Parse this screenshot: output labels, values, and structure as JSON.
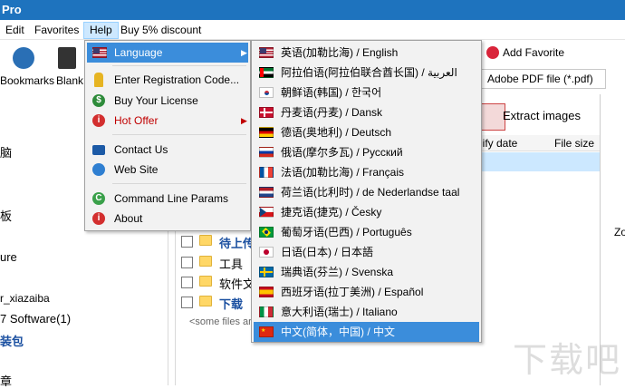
{
  "titlebar": {
    "title": "Pro"
  },
  "menubar": {
    "items": [
      "Edit",
      "Favorites",
      "Help",
      "Buy 5% discount"
    ]
  },
  "toolbar": {
    "bookmarks_label": "Bookmarks",
    "blank_label": "Blank p",
    "add_favorite_label": "Add Favorite",
    "file_type_value": "Adobe PDF file (*.pdf)",
    "extract_label": "Extract images",
    "zoom_partial": "Zo"
  },
  "left_panel": {
    "items": [
      "脑",
      "板",
      "ure",
      "r_xiazaiba",
      "7 Software(1)",
      "装包",
      "章"
    ]
  },
  "file_list": {
    "columns": {
      "modified": "lify date",
      "size": "File size"
    },
    "rows": [
      {
        "name": "待上传"
      },
      {
        "name": "工具"
      },
      {
        "name": "软件文"
      },
      {
        "name": "下载"
      }
    ],
    "hidden_note": "<some files are"
  },
  "help_menu": {
    "items": [
      {
        "label": "Language",
        "icon": "us-flag-icon",
        "submenu": true
      },
      {
        "label": "Enter Registration Code...",
        "icon": "key-icon"
      },
      {
        "label": "Buy Your License",
        "icon": "dollar-icon"
      },
      {
        "label": "Hot Offer",
        "icon": "info-icon",
        "submenu": true
      },
      {
        "label": "Contact Us",
        "icon": "mail-icon"
      },
      {
        "label": "Web Site",
        "icon": "globe-icon"
      },
      {
        "label": "Command Line Params",
        "icon": "command-icon"
      },
      {
        "label": "About",
        "icon": "info-icon"
      }
    ]
  },
  "language_menu": {
    "items": [
      {
        "label": "英语(加勒比海) / English",
        "flag": "us"
      },
      {
        "label": "阿拉伯语(阿拉伯联合酋长国) / العربية",
        "flag": "uae"
      },
      {
        "label": "朝鲜语(韩国) / 한국어",
        "flag": "korea"
      },
      {
        "label": "丹麦语(丹麦) / Dansk",
        "flag": "denmark"
      },
      {
        "label": "德语(奥地利) / Deutsch",
        "flag": "germany"
      },
      {
        "label": "俄语(摩尔多瓦) / Русский",
        "flag": "russia"
      },
      {
        "label": "法语(加勒比海) / Français",
        "flag": "france"
      },
      {
        "label": "荷兰语(比利时) / de Nederlandse taal",
        "flag": "netherlands"
      },
      {
        "label": "捷克语(捷克) / Česky",
        "flag": "czech"
      },
      {
        "label": "葡萄牙语(巴西) / Português",
        "flag": "brazil"
      },
      {
        "label": "日语(日本) / 日本語",
        "flag": "japan"
      },
      {
        "label": "瑞典语(芬兰) / Svenska",
        "flag": "sweden"
      },
      {
        "label": "西班牙语(拉丁美洲) / Español",
        "flag": "spain"
      },
      {
        "label": "意大利语(瑞士) / Italiano",
        "flag": "italy"
      },
      {
        "label": "中文(简体，中国) / 中文",
        "flag": "china",
        "selected": true
      }
    ]
  },
  "colors": {
    "titlebar": "#1e73be",
    "menu_highlight": "#3b8ddb",
    "selected_row": "#3b8ddb",
    "hot_offer_text": "#c00000"
  },
  "watermark": "下载吧"
}
